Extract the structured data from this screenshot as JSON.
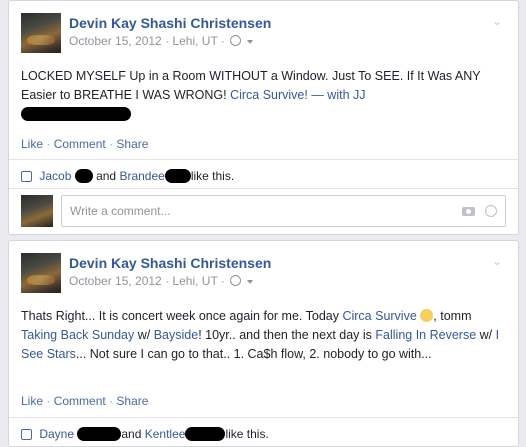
{
  "posts": [
    {
      "author": "Devin Kay Shashi Christensen",
      "date": "October 15, 2012",
      "location": "Lehi, UT",
      "text_before": "LOCKED MYSELF Up in a Room WITHOUT a Window. Just To SEE. If It Was ANY Easier to BREATHE I WAS WRONG! ",
      "link_band": "Circa Survive!",
      "text_with": " — with JJ",
      "actions": {
        "like": "Like",
        "comment": "Comment",
        "share": "Share"
      },
      "likers": {
        "first": "Jacob",
        "and": "and",
        "second": "Brandee",
        "suffix": "like this."
      },
      "comment_placeholder": "Write a comment..."
    },
    {
      "author": "Devin Kay Shashi Christensen",
      "date": "October 15, 2012",
      "location": "Lehi, UT",
      "t1": "Thats Right... It is concert week once again for me. Today ",
      "l1": "Circa Survive",
      "t2": ", tomm ",
      "l2": "Taking Back Sunday",
      "t3": " w/ ",
      "l3": "Bayside",
      "t4": "! 10yr.. and then the next day is ",
      "l4": "Falling In Reverse",
      "t5": " w/ ",
      "l5": "I See Stars",
      "t6": "... Not sure I can go to that.. 1. Ca$h flow, 2. nobody to go with...",
      "actions": {
        "like": "Like",
        "comment": "Comment",
        "share": "Share"
      },
      "likers": {
        "first": "Dayne",
        "and": "and",
        "second": "Kentlee",
        "suffix": "like this."
      }
    }
  ],
  "icons": {
    "privacy": "globe-icon",
    "options": "chevron-down-icon",
    "like": "thumbs-up-icon",
    "camera": "camera-icon",
    "emoji": "emoji-icon"
  }
}
